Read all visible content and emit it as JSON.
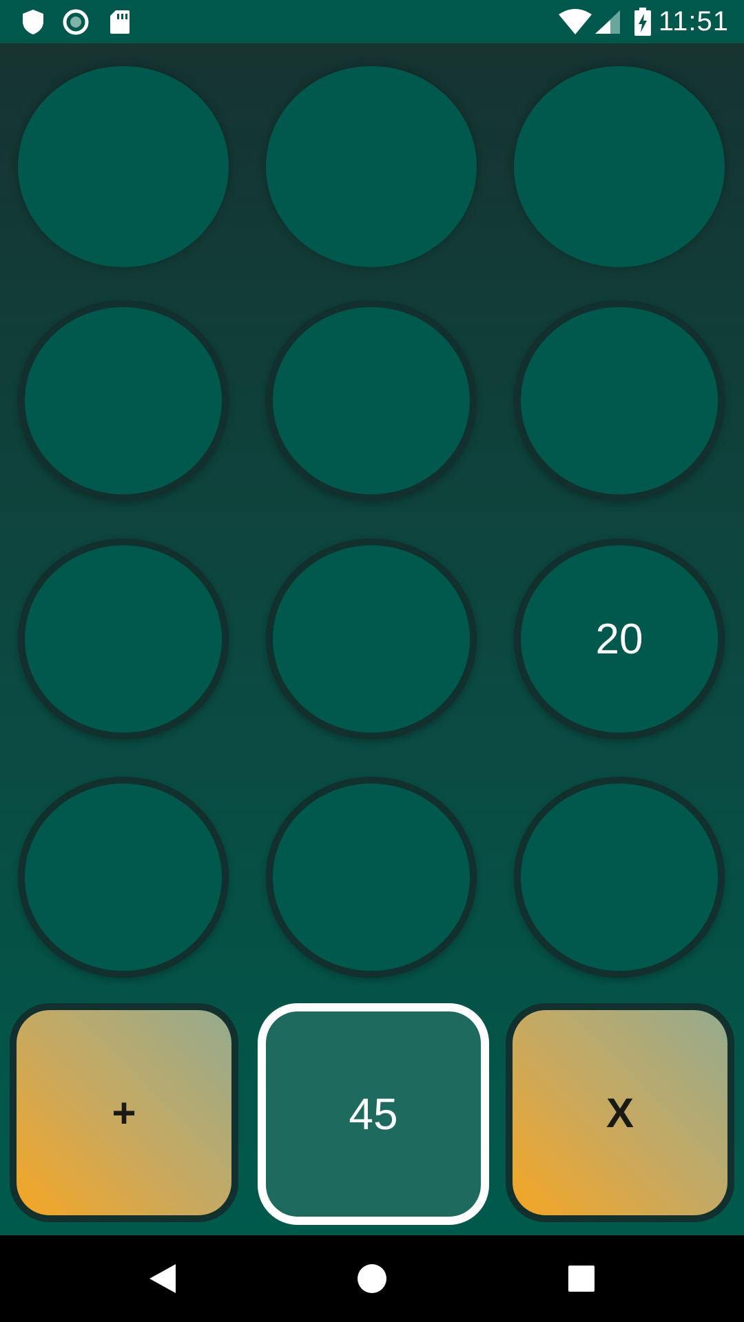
{
  "status_bar": {
    "time": "11:51",
    "left_icons": [
      "shield-icon",
      "circle-record-icon",
      "sd-card-icon"
    ],
    "right_icons": [
      "wifi-icon",
      "cellular-signal-icon",
      "battery-charging-icon"
    ]
  },
  "grid": {
    "cells": [
      {
        "value": ""
      },
      {
        "value": ""
      },
      {
        "value": ""
      },
      {
        "value": ""
      },
      {
        "value": ""
      },
      {
        "value": ""
      },
      {
        "value": ""
      },
      {
        "value": ""
      },
      {
        "value": "20"
      },
      {
        "value": ""
      },
      {
        "value": ""
      },
      {
        "value": ""
      }
    ]
  },
  "controls": {
    "plus_label": "+",
    "current_value": "45",
    "multiply_label": "X"
  },
  "nav_bar": {
    "icons": [
      "back-icon",
      "home-icon",
      "recents-icon"
    ]
  },
  "colors": {
    "status_bar": "#00574b",
    "cell_fill": "#00594c",
    "cell_ring": "#12302d",
    "accent_orange": "#f5a623",
    "value_box": "#1f6a5e"
  }
}
